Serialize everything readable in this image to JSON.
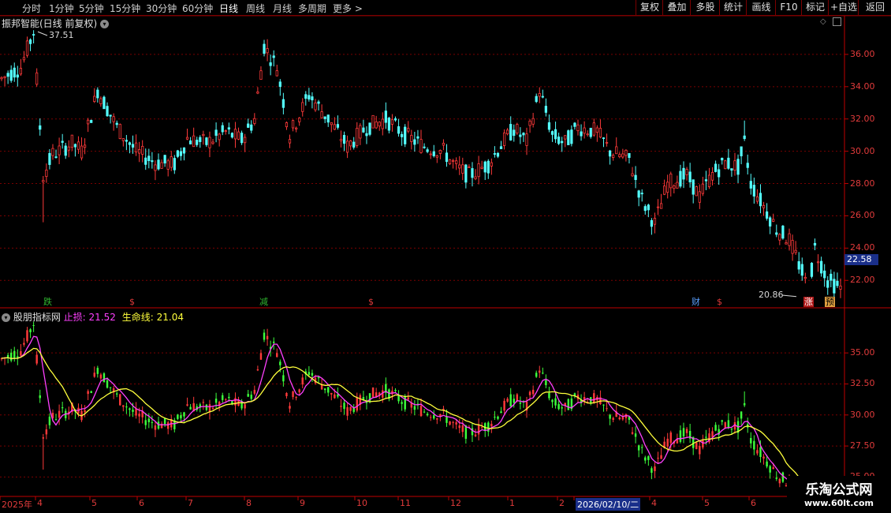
{
  "toolbar": {
    "periods": [
      "分时",
      "1分钟",
      "5分钟",
      "15分钟",
      "30分钟",
      "60分钟",
      "日线",
      "周线",
      "月线",
      "多周期",
      "更多 >"
    ],
    "active_period": "日线",
    "buttons": [
      "复权",
      "叠加",
      "多股",
      "统计",
      "画线",
      "F10",
      "标记",
      "+自选",
      "返回"
    ]
  },
  "main_panel": {
    "title": "振邦智能(日线 前复权)",
    "high_label": "37.51",
    "low_label": "20.86",
    "price_tag": "22.58",
    "markers": [
      {
        "text": "跌",
        "color": "#2fb52f",
        "bg": "#000"
      },
      {
        "text": "$",
        "color": "#e23b3b",
        "bg": "#000"
      },
      {
        "text": "减",
        "color": "#2fb52f",
        "bg": "#000"
      },
      {
        "text": "$",
        "color": "#e23b3b",
        "bg": "#000"
      },
      {
        "text": "财",
        "color": "#5aa0ff",
        "bg": "#000"
      },
      {
        "text": "$",
        "color": "#e23b3b",
        "bg": "#000"
      },
      {
        "text": "涨",
        "color": "#ffffff",
        "bg": "#b01818"
      },
      {
        "text": "预",
        "color": "#000",
        "bg": "#e0a040"
      }
    ]
  },
  "indicator_panel": {
    "name": "股朋指标网",
    "stop_label": "止损:",
    "stop_value": "21.52",
    "life_label": "生命线:",
    "life_value": "21.04"
  },
  "x_axis": {
    "labels": [
      "2025年",
      "4",
      "5",
      "6",
      "7",
      "8",
      "9",
      "10",
      "11",
      "12",
      "1",
      "2",
      "2026/02/10/二",
      "4",
      "5",
      "6"
    ]
  },
  "watermark": {
    "line1": "乐淘公式网",
    "line2": "www.60lt.com"
  },
  "colors": {
    "up": "#ff3a3a",
    "down": "#54ffff",
    "down_ind": "#3cff3c",
    "grid": "#7a0000",
    "stop_line": "#ff40ff",
    "life_line": "#ffff3c"
  },
  "chart_data": {
    "type": "candlestick",
    "y_range_main": [
      20.4,
      38.0
    ],
    "y_ticks_main": [
      22.0,
      24.0,
      26.0,
      28.0,
      30.0,
      32.0,
      34.0,
      36.0
    ],
    "y_ticks_indicator": [
      25.0,
      27.5,
      30.0,
      32.5,
      35.0
    ],
    "y_range_indicator": [
      23.5,
      38.0
    ],
    "series": [
      {
        "name": "止损",
        "last": 21.52
      },
      {
        "name": "生命线",
        "last": 21.04
      }
    ],
    "price_path": [
      [
        0,
        34.5
      ],
      [
        6,
        35.2
      ],
      [
        10,
        37.4
      ],
      [
        13,
        28.5
      ],
      [
        16,
        29.8
      ],
      [
        22,
        30.5
      ],
      [
        25,
        30.0
      ],
      [
        30,
        33.8
      ],
      [
        36,
        31.5
      ],
      [
        42,
        30.0
      ],
      [
        48,
        29.3
      ],
      [
        54,
        29.2
      ],
      [
        58,
        30.8
      ],
      [
        64,
        30.5
      ],
      [
        70,
        31.2
      ],
      [
        75,
        30.7
      ],
      [
        79,
        32.0
      ],
      [
        82,
        36.5
      ],
      [
        86,
        35.2
      ],
      [
        90,
        31.0
      ],
      [
        96,
        33.5
      ],
      [
        102,
        32.0
      ],
      [
        108,
        30.3
      ],
      [
        114,
        31.5
      ],
      [
        120,
        32.0
      ],
      [
        126,
        31.0
      ],
      [
        132,
        30.3
      ],
      [
        138,
        30.0
      ],
      [
        142,
        29.0
      ],
      [
        146,
        28.5
      ],
      [
        152,
        29.2
      ],
      [
        156,
        30.4
      ],
      [
        160,
        31.4
      ],
      [
        164,
        30.6
      ],
      [
        168,
        33.8
      ],
      [
        172,
        31.0
      ],
      [
        176,
        30.5
      ],
      [
        180,
        31.5
      ],
      [
        186,
        31.2
      ],
      [
        190,
        30.0
      ],
      [
        196,
        29.5
      ],
      [
        200,
        27.0
      ],
      [
        204,
        25.5
      ],
      [
        208,
        28.0
      ],
      [
        214,
        28.5
      ],
      [
        218,
        27.2
      ],
      [
        222,
        28.6
      ],
      [
        226,
        29.3
      ],
      [
        230,
        29.0
      ],
      [
        232,
        30.5
      ],
      [
        234,
        28.0
      ],
      [
        238,
        26.6
      ],
      [
        242,
        25.2
      ],
      [
        246,
        24.5
      ],
      [
        250,
        22.5
      ],
      [
        252,
        21.3
      ],
      [
        254,
        24.0
      ],
      [
        258,
        22.0
      ],
      [
        262,
        21.5
      ]
    ]
  }
}
